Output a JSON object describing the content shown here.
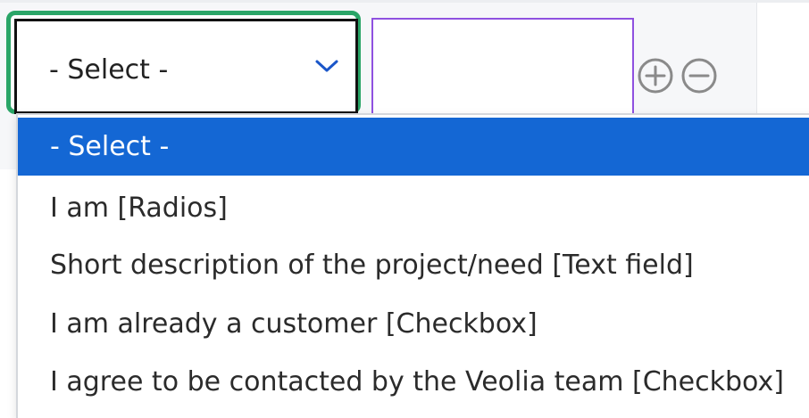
{
  "select": {
    "value": "- Select -",
    "chevron_icon": "chevron-down-icon"
  },
  "text_input": {
    "value": ""
  },
  "buttons": {
    "add_icon": "plus-circle-icon",
    "remove_icon": "minus-circle-icon"
  },
  "dropdown": {
    "options": [
      {
        "label": "- Select -",
        "selected": true
      },
      {
        "label": "I am [Radios]",
        "selected": false
      },
      {
        "label": "Short description of the project/need [Text field]",
        "selected": false
      },
      {
        "label": "I am already a customer [Checkbox]",
        "selected": false
      },
      {
        "label": "I agree to be contacted by the Veolia team [Checkbox]",
        "selected": false
      }
    ]
  },
  "colors": {
    "focus_ring": "#2aa567",
    "selected_option_bg": "#1467d4",
    "text_input_border": "#8f51e0",
    "chevron": "#1a56c9",
    "circle_icons": "#8a8a8a"
  }
}
